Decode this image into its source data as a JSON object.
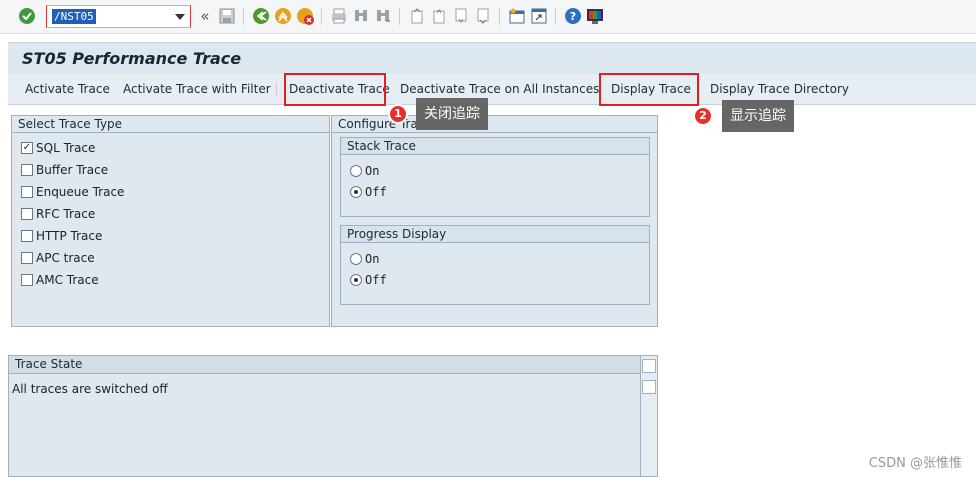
{
  "toolbar": {
    "command_field_value": "/NST05",
    "icons": [
      "enter-check-icon",
      "back-chevrons-icon",
      "save-icon",
      "back-icon",
      "exit-icon",
      "cancel-icon",
      "print-icon",
      "find-icon",
      "find-next-icon",
      "first-page-icon",
      "prev-page-icon",
      "next-page-icon",
      "last-page-icon",
      "create-session-icon",
      "shortcut-icon",
      "help-icon",
      "customize-layout-icon"
    ]
  },
  "title": "ST05 Performance Trace",
  "app_toolbar": {
    "activate": "Activate Trace",
    "activate_filter": "Activate Trace with Filter",
    "deactivate": "Deactivate Trace",
    "deactivate_all": "Deactivate Trace on All Instances",
    "display": "Display Trace",
    "display_dir": "Display Trace Directory"
  },
  "annotations": [
    {
      "number": "1",
      "text": "关闭追踪"
    },
    {
      "number": "2",
      "text": "显示追踪"
    }
  ],
  "trace_type": {
    "header": "Select Trace Type",
    "items": [
      {
        "label": "SQL Trace",
        "checked": true
      },
      {
        "label": "Buffer Trace",
        "checked": false
      },
      {
        "label": "Enqueue Trace",
        "checked": false
      },
      {
        "label": "RFC Trace",
        "checked": false
      },
      {
        "label": "HTTP Trace",
        "checked": false
      },
      {
        "label": "APC trace",
        "checked": false
      },
      {
        "label": "AMC Trace",
        "checked": false
      }
    ]
  },
  "configure": {
    "header": "Configure Trace",
    "stack": {
      "header": "Stack Trace",
      "options": [
        "On",
        "Off"
      ],
      "selected": "Off"
    },
    "progress": {
      "header": "Progress Display",
      "options": [
        "On",
        "Off"
      ],
      "selected": "Off"
    }
  },
  "state": {
    "header": "Trace State",
    "text": "All traces are switched off"
  },
  "watermark": "CSDN @张惟惟",
  "colors": {
    "highlight": "#e02020",
    "badge": "#e63030",
    "tip": "#666666"
  }
}
